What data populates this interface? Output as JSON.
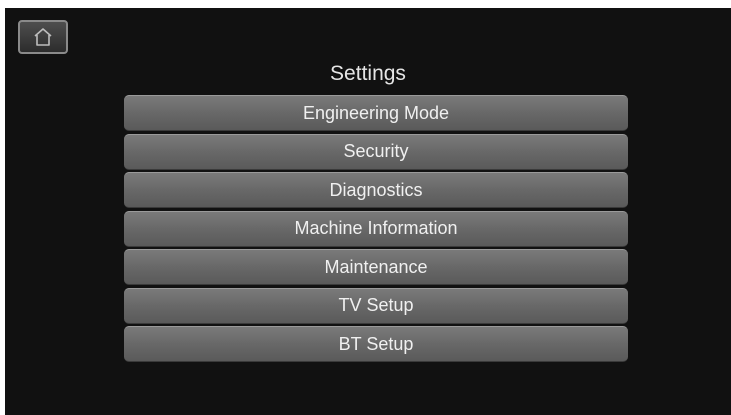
{
  "header": {
    "home_icon": "home-icon",
    "title": "Settings"
  },
  "menu": {
    "items": [
      {
        "label": "Engineering Mode"
      },
      {
        "label": "Security"
      },
      {
        "label": "Diagnostics"
      },
      {
        "label": "Machine Information"
      },
      {
        "label": "Maintenance"
      },
      {
        "label": "TV Setup"
      },
      {
        "label": "BT Setup"
      }
    ]
  },
  "colors": {
    "background": "#111111",
    "button": "#6a6a6a",
    "text": "#f0f0f0"
  }
}
